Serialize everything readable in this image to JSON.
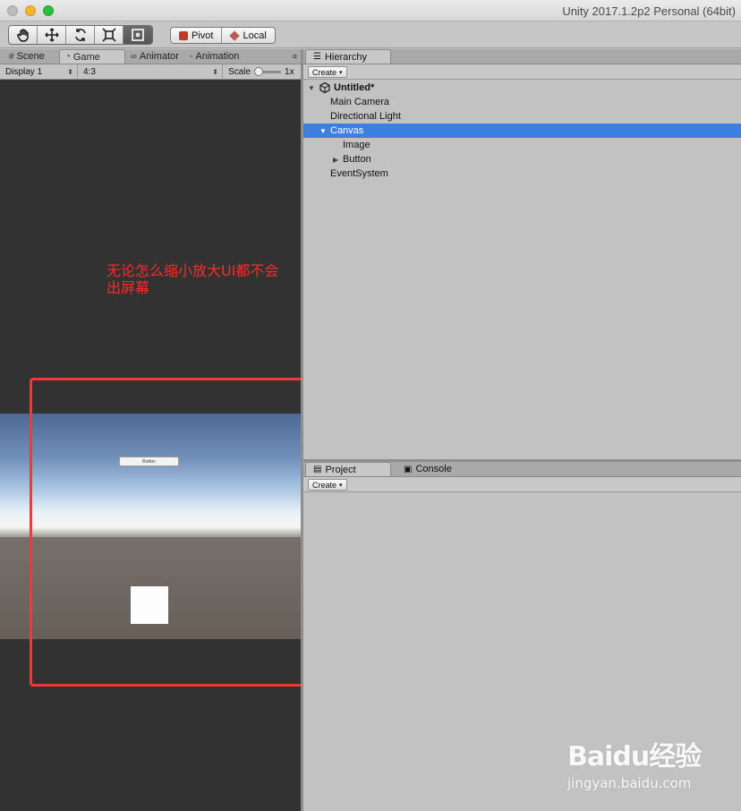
{
  "window": {
    "title": "Unity 2017.1.2p2 Personal (64bit)"
  },
  "toolbar": {
    "tools": [
      {
        "name": "hand-tool",
        "icon": "hand-icon"
      },
      {
        "name": "move-tool",
        "icon": "move-arrows-icon"
      },
      {
        "name": "rotate-tool",
        "icon": "rotate-icon"
      },
      {
        "name": "scale-tool",
        "icon": "scale-icon"
      },
      {
        "name": "rect-tool",
        "icon": "rect-transform-icon",
        "active": true
      }
    ],
    "pivot_label": "Pivot",
    "local_label": "Local"
  },
  "left_tabs": {
    "scene": "Scene",
    "game": "Game",
    "animator": "Animator",
    "animation": "Animation",
    "menu_icon": "≡"
  },
  "game_toolbar": {
    "display": "Display 1",
    "aspect": "4:3",
    "scale_label": "Scale",
    "scale_value": "1x"
  },
  "game_view": {
    "button_text": "Button"
  },
  "annotation": {
    "line1": "无论怎么缩小放大UI都不会",
    "line2": "出屏幕",
    "color": "#ff2a2a"
  },
  "hierarchy": {
    "tab_label": "Hierarchy",
    "create_label": "Create",
    "scene_name": "Untitled*",
    "items": [
      {
        "label": "Main Camera",
        "indent": 1
      },
      {
        "label": "Directional Light",
        "indent": 1
      },
      {
        "label": "Canvas",
        "indent": 1,
        "selected": true,
        "expanded": true
      },
      {
        "label": "Image",
        "indent": 2
      },
      {
        "label": "Button",
        "indent": 2,
        "collapsed": true
      },
      {
        "label": "EventSystem",
        "indent": 1
      }
    ],
    "selection_color": "#3d80df"
  },
  "project": {
    "tab_label": "Project",
    "console_label": "Console",
    "create_label": "Create"
  },
  "watermark": {
    "main": "Baidu经验",
    "sub": "jingyan.baidu.com"
  }
}
